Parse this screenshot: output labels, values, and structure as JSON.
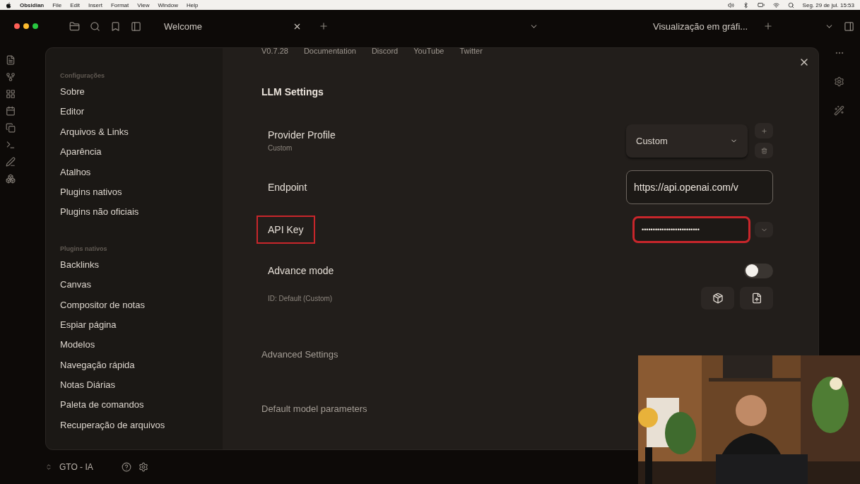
{
  "menubar": {
    "app": "Obsidian",
    "menus": [
      "File",
      "Edit",
      "Insert",
      "Format",
      "View",
      "Window",
      "Help"
    ],
    "clock": "Seg. 29 de jul. 15:53"
  },
  "tabs": [
    {
      "title": "Welcome",
      "kind": "plain"
    },
    {
      "title": "Visualização em gráfi...",
      "kind": "graph"
    }
  ],
  "settings": {
    "sidebar_groups": [
      {
        "heading": "Configurações",
        "items": [
          "Sobre",
          "Editor",
          "Arquivos & Links",
          "Aparência",
          "Atalhos",
          "Plugins nativos",
          "Plugins não oficiais"
        ]
      },
      {
        "heading": "Plugins nativos",
        "items": [
          "Backlinks",
          "Canvas",
          "Compositor de notas",
          "Espiar página",
          "Modelos",
          "Navegação rápida",
          "Notas Diárias",
          "Paleta de comandos",
          "Recuperação de arquivos"
        ]
      }
    ],
    "links": [
      "V0.7.28",
      "Documentation",
      "Discord",
      "YouTube",
      "Twitter"
    ],
    "section_title": "LLM Settings",
    "rows": [
      {
        "kind": "select",
        "label": "Provider Profile",
        "description": "Custom",
        "value": "Custom",
        "highlighted": false
      },
      {
        "kind": "text",
        "label": "Endpoint",
        "value": "https://api.openai.com/v",
        "highlighted": false
      },
      {
        "kind": "password",
        "label": "API Key",
        "value": "••••••••••••••••••••••••••",
        "highlighted": true
      },
      {
        "kind": "toggle",
        "label": "Advance mode",
        "on": false,
        "highlighted": false
      }
    ],
    "id_text": "ID: Default (Custom)",
    "collapsed_sections": [
      "Advanced Settings",
      "Default model parameters"
    ]
  },
  "vault": {
    "name": "GTO - IA"
  }
}
